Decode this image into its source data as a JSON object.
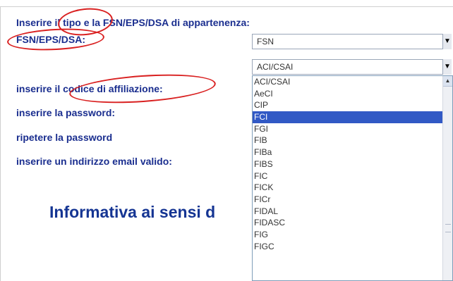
{
  "form": {
    "header": "Inserire il tipo e la FSN/EPS/DSA di appartenenza:",
    "fsn_label": "FSN/EPS/DSA:",
    "codice_label": "inserire il codice di affiliazione:",
    "password_label": "inserire la password:",
    "repeat_password_label": "ripetere la password",
    "email_label": "inserire un indirizzo email valido:"
  },
  "selects": {
    "type_value": "FSN",
    "org_value": "ACI/CSAI"
  },
  "dropdown": {
    "options": [
      "ACI/CSAI",
      "AeCI",
      "CIP",
      "FCI",
      "FGI",
      "FIB",
      "FIBa",
      "FIBS",
      "FIC",
      "FICK",
      "FICr",
      "FIDAL",
      "FIDASC",
      "FIG",
      "FIGC"
    ],
    "selected": "FCI",
    "selected_color": "#3159c5"
  },
  "section": {
    "title_partial": "Informativa ai sensi d"
  },
  "annotations": {
    "color": "#d92020"
  }
}
